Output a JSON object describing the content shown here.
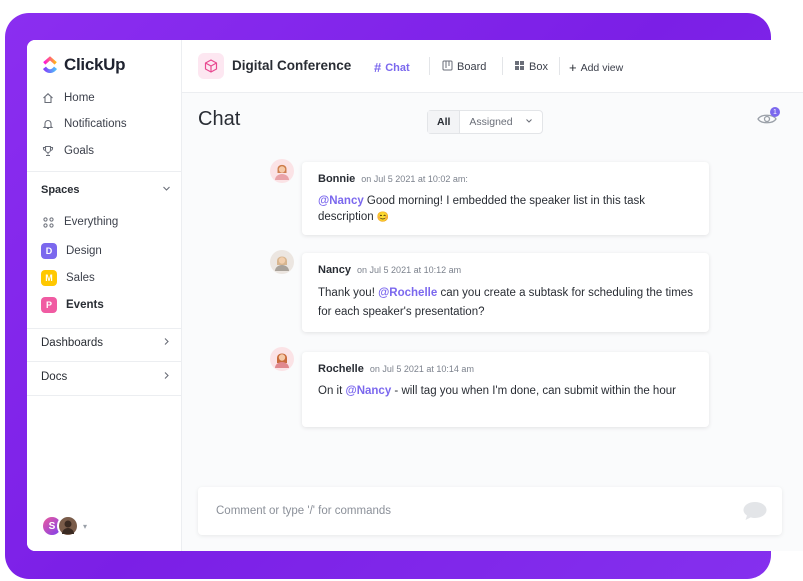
{
  "brand": {
    "name": "ClickUp"
  },
  "sidebar": {
    "nav": [
      {
        "label": "Home",
        "icon": "home-icon"
      },
      {
        "label": "Notifications",
        "icon": "bell-icon"
      },
      {
        "label": "Goals",
        "icon": "trophy-icon"
      }
    ],
    "spaces_label": "Spaces",
    "everything_label": "Everything",
    "spaces": [
      {
        "letter": "D",
        "label": "Design",
        "color": "#7b68ee"
      },
      {
        "letter": "M",
        "label": "Sales",
        "color": "#ffc800"
      },
      {
        "letter": "P",
        "label": "Events",
        "color": "#f05ba2"
      }
    ],
    "sections": [
      {
        "label": "Dashboards"
      },
      {
        "label": "Docs"
      }
    ],
    "user_initial": "S"
  },
  "header": {
    "project_title": "Digital Conference",
    "tabs": [
      {
        "label": "Chat",
        "icon": "hash-icon",
        "active": true
      },
      {
        "label": "Board",
        "icon": "board-icon",
        "active": false
      },
      {
        "label": "Box",
        "icon": "grid-icon",
        "active": false
      }
    ],
    "add_view_label": "Add view"
  },
  "chat": {
    "title": "Chat",
    "filter_all": "All",
    "filter_assigned": "Assigned",
    "watchers_count": "1",
    "messages": [
      {
        "author": "Bonnie",
        "time": "on Jul 5 2021 at 10:02 am:",
        "mention": "@Nancy",
        "text_before": "",
        "text_after": " Good morning! I embedded the speaker list in this task description",
        "emoji": "😊"
      },
      {
        "author": "Nancy",
        "time": "on Jul 5 2021 at 10:12 am",
        "mention": "@Rochelle",
        "text_before": "Thank you! ",
        "text_after": " can you create a subtask for scheduling the times for each speaker's presentation?",
        "emoji": ""
      },
      {
        "author": "Rochelle",
        "time": "on Jul 5 2021 at 10:14 am",
        "mention": "@Nancy",
        "text_before": "On it ",
        "text_after": " - will tag you when I'm done, can submit within the hour",
        "emoji": ""
      }
    ],
    "comment_placeholder": "Comment or type '/' for commands"
  },
  "colors": {
    "accent": "#7b68ee",
    "frame": "#8b2ef0"
  }
}
